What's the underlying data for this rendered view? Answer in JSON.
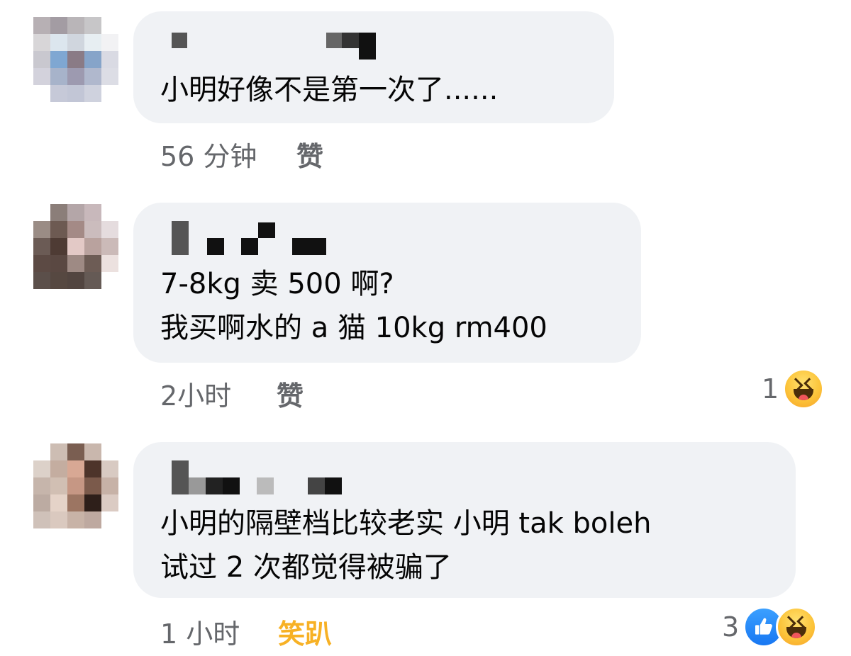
{
  "colors": {
    "bubble_bg": "#f0f2f5",
    "meta_text": "#65676b",
    "haha_react_text": "#f7b125",
    "like_blue": "#1877f2"
  },
  "comments": [
    {
      "text_lines": [
        "小明好像不是第一次了......"
      ],
      "time": "56 分钟",
      "react_label": "赞",
      "react_state": "none",
      "reaction_count": "",
      "reaction_icons": []
    },
    {
      "text_lines": [
        "7-8kg 卖 500 啊?",
        "我买啊水的 a 猫 10kg rm400"
      ],
      "time": "2小时",
      "react_label": "赞",
      "react_state": "none",
      "reaction_count": "1",
      "reaction_icons": [
        "haha-icon"
      ]
    },
    {
      "text_lines": [
        "小明的隔壁档比较老实 小明 tak boleh",
        "试过 2 次都觉得被骗了"
      ],
      "time": "1 小时",
      "react_label": "笑趴",
      "react_state": "haha",
      "reaction_count": "3",
      "reaction_icons": [
        "like-icon",
        "haha-icon"
      ]
    }
  ]
}
